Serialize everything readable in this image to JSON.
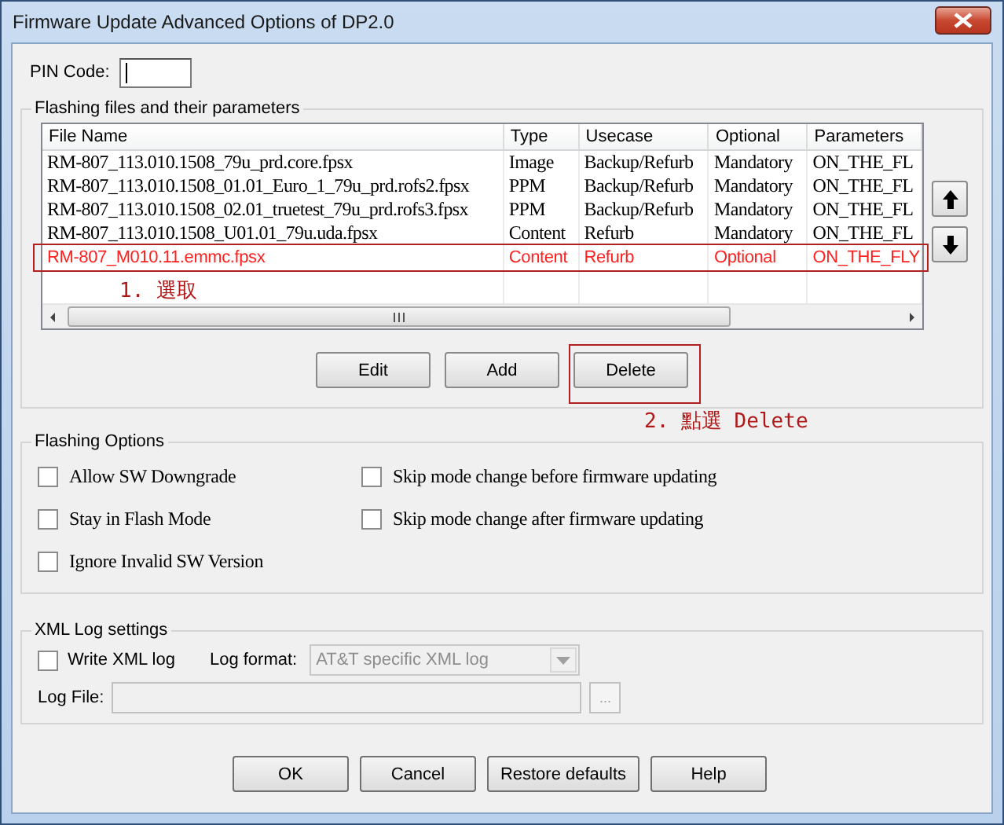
{
  "window": {
    "title": "Firmware Update Advanced Options of DP2.0"
  },
  "pin_code": {
    "label": "PIN Code:"
  },
  "files_group": {
    "title": "Flashing files and their parameters",
    "columns": [
      "File Name",
      "Type",
      "Usecase",
      "Optional",
      "Parameters"
    ],
    "rows": [
      {
        "cells": [
          "RM-807_113.010.1508_79u_prd.core.fpsx",
          "Image",
          "Backup/Refurb",
          "Mandatory",
          "ON_THE_FL"
        ],
        "selected": false
      },
      {
        "cells": [
          "RM-807_113.010.1508_01.01_Euro_1_79u_prd.rofs2.fpsx",
          "PPM",
          "Backup/Refurb",
          "Mandatory",
          "ON_THE_FL"
        ],
        "selected": false
      },
      {
        "cells": [
          "RM-807_113.010.1508_02.01_truetest_79u_prd.rofs3.fpsx",
          "PPM",
          "Backup/Refurb",
          "Mandatory",
          "ON_THE_FL"
        ],
        "selected": false
      },
      {
        "cells": [
          "RM-807_113.010.1508_U01.01_79u.uda.fpsx",
          "Content",
          "Refurb",
          "Mandatory",
          "ON_THE_FL"
        ],
        "selected": false
      },
      {
        "cells": [
          "RM-807_M010.11.emmc.fpsx",
          "Content",
          "Refurb",
          "Optional",
          "ON_THE_FLY"
        ],
        "selected": true
      }
    ],
    "buttons": [
      "Edit",
      "Add",
      "Delete"
    ]
  },
  "annotations": [
    {
      "text": "1. 選取"
    },
    {
      "text": "2. 點選 Delete"
    }
  ],
  "flashing_options": {
    "title": "Flashing Options",
    "options": [
      {
        "label": "Allow SW Downgrade",
        "checked": false
      },
      {
        "label": "Skip mode change before firmware updating",
        "checked": false
      },
      {
        "label": "Stay in Flash Mode",
        "checked": false
      },
      {
        "label": "Skip mode change after firmware updating",
        "checked": false
      },
      {
        "label": "Ignore Invalid SW Version",
        "checked": false
      }
    ]
  },
  "xml_log": {
    "title": "XML Log settings",
    "write_xml_log": {
      "label": "Write XML log",
      "checked": false
    },
    "log_format": {
      "label": "Log format:",
      "value": "AT&T specific XML log",
      "disabled": true
    },
    "log_file": {
      "label": "Log File:",
      "disabled": true,
      "browse": "..."
    }
  },
  "buttons": [
    "OK",
    "Cancel",
    "Restore defaults",
    "Help"
  ]
}
